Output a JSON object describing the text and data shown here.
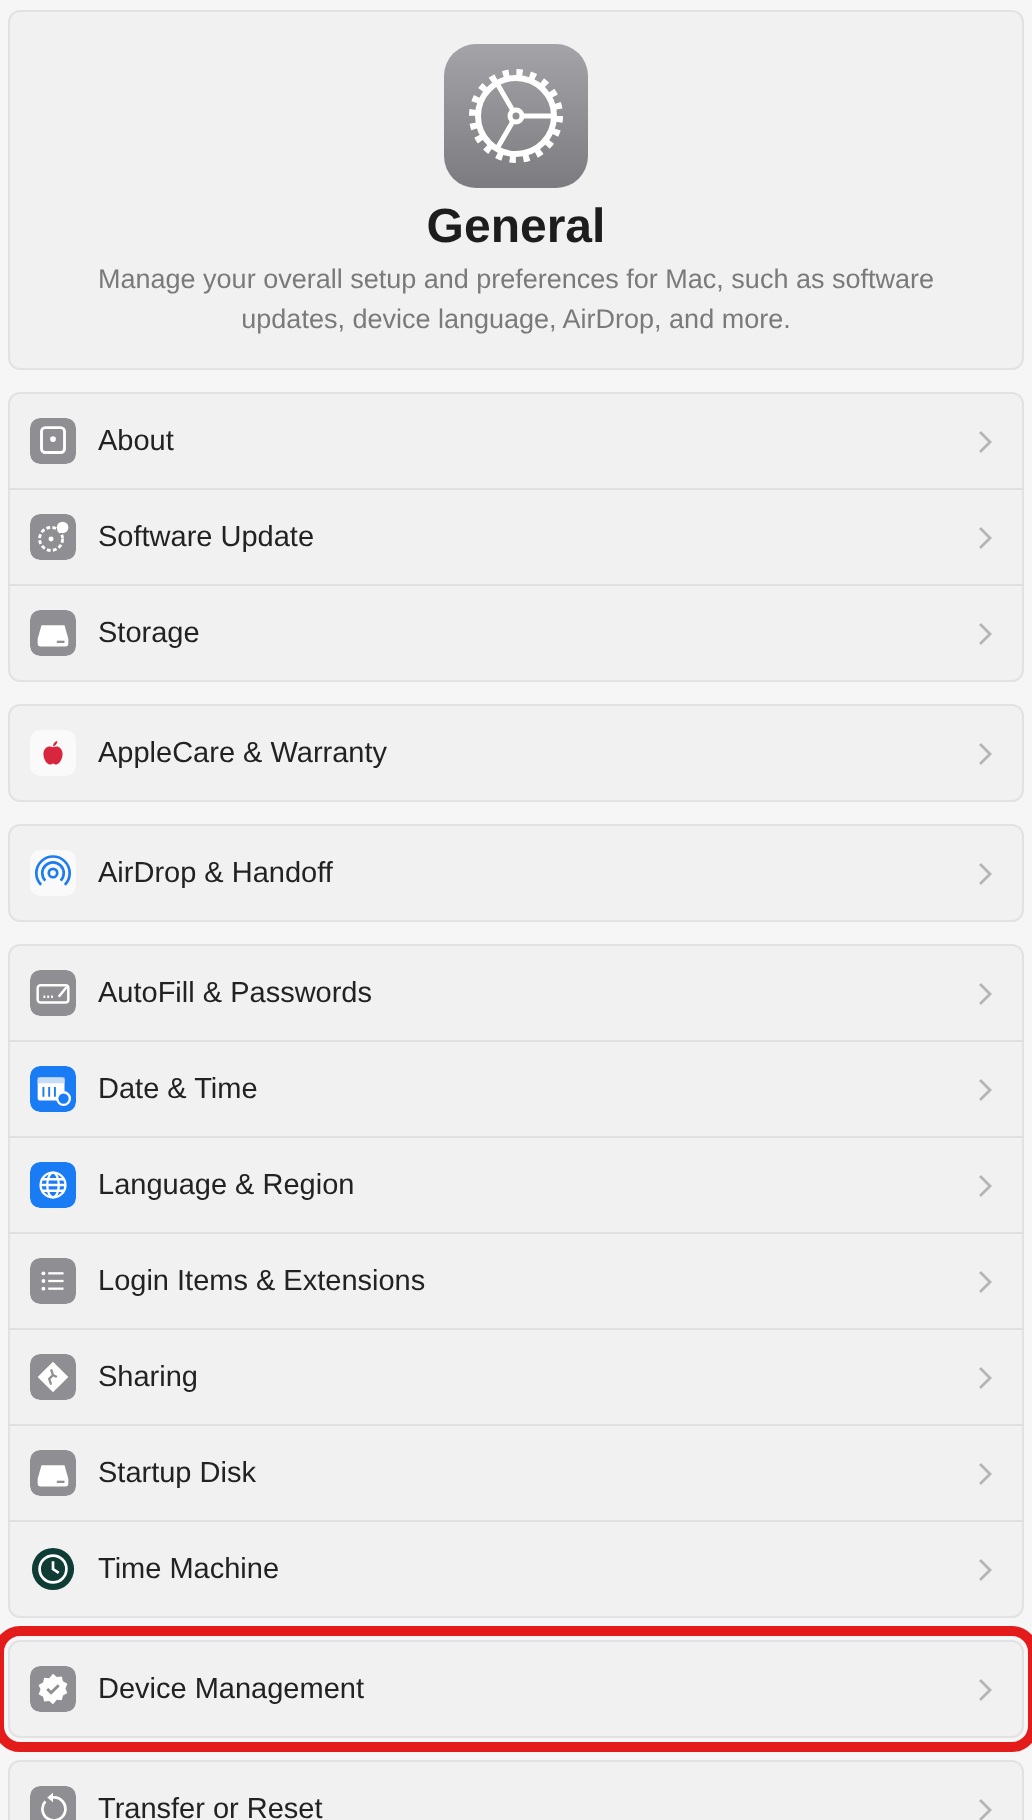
{
  "header": {
    "title": "General",
    "description": "Manage your overall setup and preferences for Mac, such as software updates, device language, AirDrop, and more."
  },
  "groups": [
    {
      "highlighted": false,
      "rows": [
        {
          "label": "About",
          "kind": "about"
        },
        {
          "label": "Software Update",
          "kind": "update"
        },
        {
          "label": "Storage",
          "kind": "drive"
        }
      ]
    },
    {
      "highlighted": false,
      "rows": [
        {
          "label": "AppleCare & Warranty",
          "kind": "apple"
        }
      ]
    },
    {
      "highlighted": false,
      "rows": [
        {
          "label": "AirDrop & Handoff",
          "kind": "airdrop"
        }
      ]
    },
    {
      "highlighted": false,
      "rows": [
        {
          "label": "AutoFill & Passwords",
          "kind": "keyboard"
        },
        {
          "label": "Date & Time",
          "kind": "calendar"
        },
        {
          "label": "Language & Region",
          "kind": "globe"
        },
        {
          "label": "Login Items & Extensions",
          "kind": "list"
        },
        {
          "label": "Sharing",
          "kind": "sharing"
        },
        {
          "label": "Startup Disk",
          "kind": "drive"
        },
        {
          "label": "Time Machine",
          "kind": "clock"
        }
      ]
    },
    {
      "highlighted": true,
      "rows": [
        {
          "label": "Device Management",
          "kind": "badge"
        }
      ]
    },
    {
      "highlighted": false,
      "rows": [
        {
          "label": "Transfer or Reset",
          "kind": "reset"
        }
      ]
    }
  ]
}
